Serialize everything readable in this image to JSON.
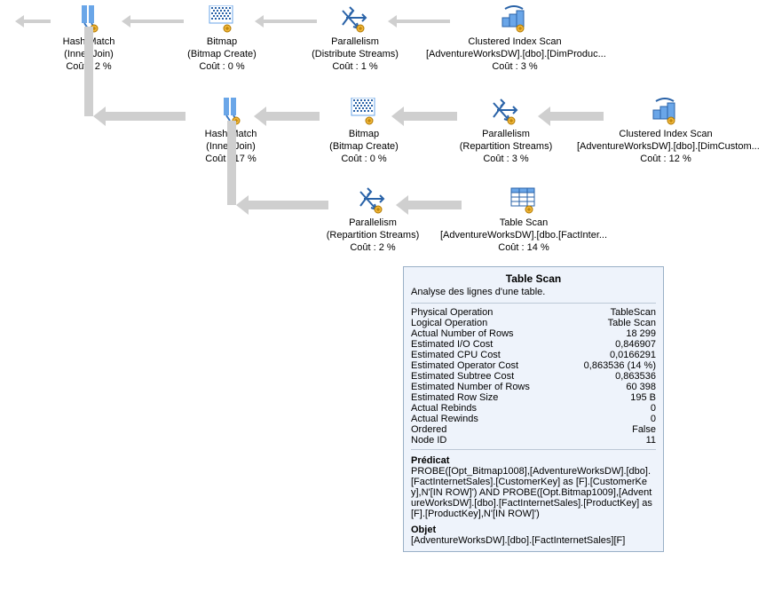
{
  "nodes": {
    "n0": {
      "l1": "Hash Match",
      "l2": "(Inner Join)",
      "l3": "Coût : 2 %"
    },
    "n1": {
      "l1": "Bitmap",
      "l2": "(Bitmap Create)",
      "l3": "Coût : 0 %"
    },
    "n2": {
      "l1": "Parallelism",
      "l2": "(Distribute Streams)",
      "l3": "Coût : 1 %"
    },
    "n3": {
      "l1": "Clustered Index Scan",
      "l2": "[AdventureWorksDW].[dbo].[DimProduc...",
      "l3": "Coût : 3 %"
    },
    "n4": {
      "l1": "Hash Match",
      "l2": "(Inner Join)",
      "l3": "Coût : 17 %"
    },
    "n5": {
      "l1": "Bitmap",
      "l2": "(Bitmap Create)",
      "l3": "Coût : 0 %"
    },
    "n6": {
      "l1": "Parallelism",
      "l2": "(Repartition Streams)",
      "l3": "Coût : 3 %"
    },
    "n7": {
      "l1": "Clustered Index Scan",
      "l2": "[AdventureWorksDW].[dbo].[DimCustom...",
      "l3": "Coût : 12 %"
    },
    "n8": {
      "l1": "Parallelism",
      "l2": "(Repartition Streams)",
      "l3": "Coût : 2 %"
    },
    "n9": {
      "l1": "Table Scan",
      "l2": "[AdventureWorksDW].[dbo.[FactInter...",
      "l3": "Coût : 14 %"
    }
  },
  "tooltip": {
    "title": "Table Scan",
    "desc": "Analyse des lignes d'une table.",
    "rows": [
      {
        "k": "Physical Operation",
        "v": "TableScan"
      },
      {
        "k": "Logical Operation",
        "v": "Table Scan"
      },
      {
        "k": "Actual Number of Rows",
        "v": "18 299"
      },
      {
        "k": "Estimated I/O Cost",
        "v": "0,846907"
      },
      {
        "k": "Estimated CPU Cost",
        "v": "0,0166291"
      },
      {
        "k": "Estimated Operator Cost",
        "v": "0,863536 (14 %)"
      },
      {
        "k": "Estimated Subtree Cost",
        "v": "0,863536"
      },
      {
        "k": "Estimated Number of Rows",
        "v": "60 398"
      },
      {
        "k": "Estimated Row Size",
        "v": "195 B"
      },
      {
        "k": "Actual Rebinds",
        "v": "0"
      },
      {
        "k": "Actual Rewinds",
        "v": "0"
      },
      {
        "k": "Ordered",
        "v": "False"
      },
      {
        "k": "Node ID",
        "v": "11"
      }
    ],
    "predLabel": "Prédicat",
    "predText": "PROBE([Opt_Bitmap1008],[AdventureWorksDW].[dbo].[FactInternetSales].[CustomerKey] as [F].[CustomerKey],N'[IN ROW]') AND PROBE([Opt.Bitmap1009],[AdventureWorksDW].[dbo].[FactInternetSales].[ProductKey] as [F].[ProductKey],N'[IN ROW]')",
    "objLabel": "Objet",
    "objText": "[AdventureWorksDW].[dbo].[FactInternetSales][F]"
  }
}
